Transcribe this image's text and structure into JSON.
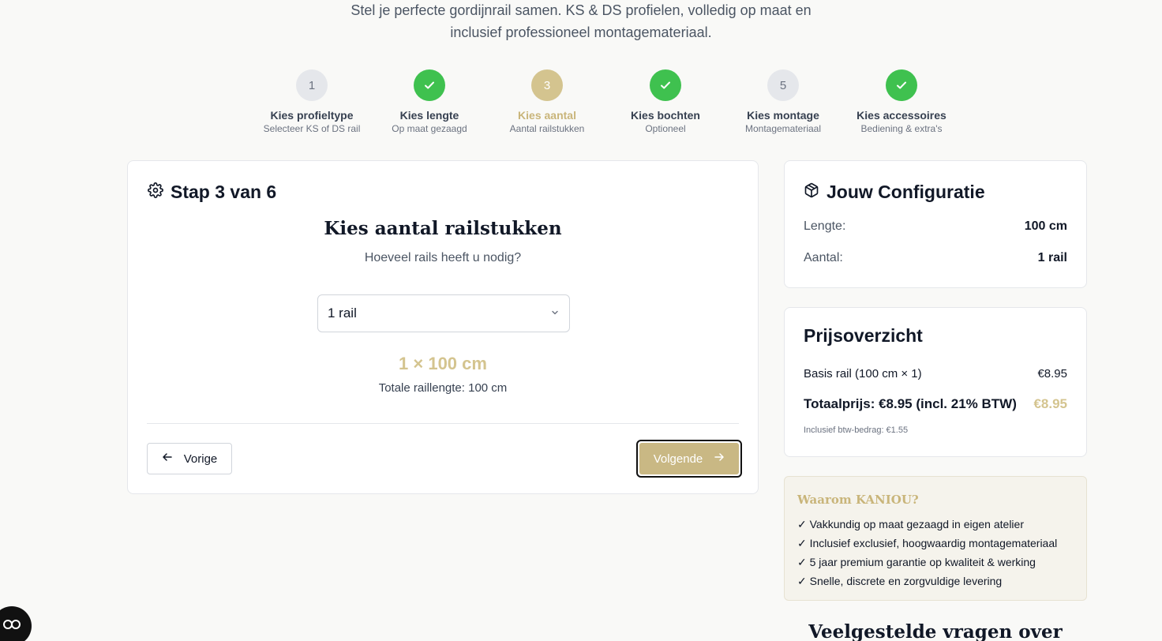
{
  "intro": {
    "text": "Stel je perfecte gordijnrail samen. KS & DS profielen, volledig op maat en inclusief professioneel montagemateriaal."
  },
  "steps": [
    {
      "label": "Kies profieltype",
      "sub": "Selecteer KS of DS rail",
      "number": "1",
      "state": "pending"
    },
    {
      "label": "Kies lengte",
      "sub": "Op maat gezaagd",
      "number": "2",
      "state": "done"
    },
    {
      "label": "Kies aantal",
      "sub": "Aantal railstukken",
      "number": "3",
      "state": "active"
    },
    {
      "label": "Kies bochten",
      "sub": "Optioneel",
      "number": "4",
      "state": "done"
    },
    {
      "label": "Kies montage",
      "sub": "Montagemateriaal",
      "number": "5",
      "state": "pending"
    },
    {
      "label": "Kies accessoires",
      "sub": "Bediening & extra's",
      "number": "6",
      "state": "done"
    }
  ],
  "main": {
    "step_title": "Stap 3 van 6",
    "heading": "Kies aantal railstukken",
    "subheading": "Hoeveel rails heeft u nodig?",
    "select_value": "1 rail",
    "result": "1 × 100 cm",
    "total_length": "Totale raillengte: 100 cm",
    "prev_label": "Vorige",
    "next_label": "Volgende"
  },
  "config": {
    "title": "Jouw Configuratie",
    "rows": [
      {
        "key": "Lengte:",
        "value": "100 cm"
      },
      {
        "key": "Aantal:",
        "value": "1 rail"
      }
    ]
  },
  "price": {
    "title": "Prijsoverzicht",
    "base_label": "Basis rail (100 cm × 1)",
    "base_value": "€8.95",
    "total_label": "Totaalprijs: €8.95 (incl. 21% BTW)",
    "total_value": "€8.95",
    "vat_note": "Inclusief btw-bedrag: €1.55"
  },
  "why": {
    "title": "Waarom KANIOU?",
    "items": [
      "✓ Vakkundig op maat gezaagd in eigen atelier",
      "✓ Inclusief exclusief, hoogwaardig montagemateriaal",
      "✓ 5 jaar premium garantie op kwaliteit & werking",
      "✓ Snelle, discrete en zorgvuldige levering"
    ]
  },
  "faq": {
    "heading": "Veelgestelde vragen over"
  },
  "colors": {
    "accent": "#d4c48f",
    "success": "#3fc14f",
    "pending": "#e5e7eb"
  }
}
